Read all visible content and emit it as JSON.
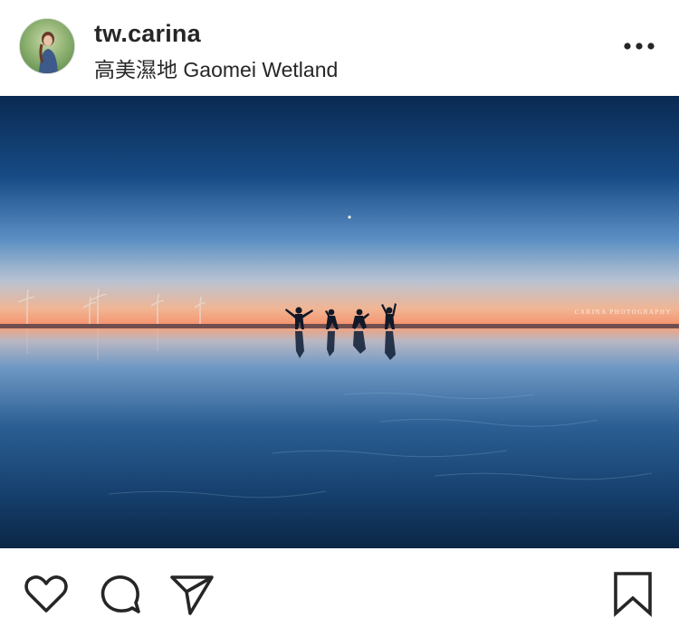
{
  "post": {
    "username": "tw.carina",
    "location": "高美濕地 Gaomei Wetland",
    "more_icon": "more-horizontal-icon"
  },
  "photo": {
    "watermark_line1": "CARINA PHOTOGRAPHY",
    "watermark_line2": ""
  },
  "actions": {
    "like_icon": "heart-icon",
    "comment_icon": "comment-icon",
    "share_icon": "send-icon",
    "save_icon": "bookmark-icon"
  },
  "colors": {
    "text": "#262626",
    "sky_top": "#0b2a52",
    "horizon_glow": "#f2a27a",
    "water": "#163f6e"
  }
}
